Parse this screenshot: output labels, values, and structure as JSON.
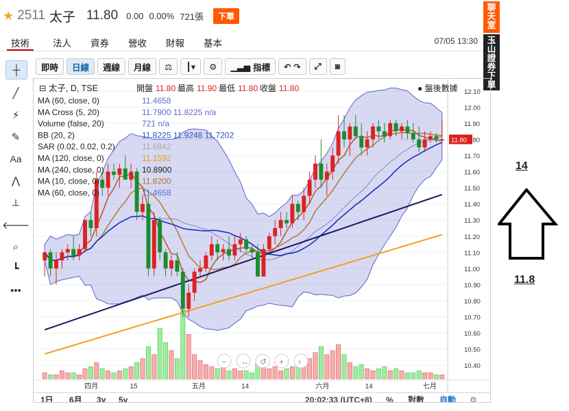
{
  "stock": {
    "code": "2511",
    "name": "太子",
    "price": "11.80",
    "change": "0.00",
    "change_pct": "0.00%",
    "volume": "721張",
    "sell_button": "下單"
  },
  "tabs": [
    "技術",
    "法人",
    "資券",
    "營收",
    "財報",
    "基本"
  ],
  "datetime": "07/05 13:30",
  "side_tags": {
    "tag1": "聊天室",
    "tag2": "玉山證券下單"
  },
  "toolbar": [
    "即時",
    "日線",
    "週線",
    "月線"
  ],
  "toolbar_indicators": "指標",
  "legend": {
    "title": "太子, D, TSE",
    "ohlc_label_open": "開盤",
    "open": "11.80",
    "ohlc_label_high": "最高",
    "high": "11.90",
    "ohlc_label_low": "最低",
    "low": "11.80",
    "ohlc_label_close": "收盤",
    "close": "11.80",
    "after_hours": "盤後數據",
    "rows": [
      {
        "label": "MA (60, close, 0)",
        "values": "11.4658"
      },
      {
        "label": "MA Cross (5, 20)",
        "values": "11.7900  11.8225  n/a"
      },
      {
        "label": "Volume (false, 20)",
        "values": "721  n/a"
      },
      {
        "label": "BB (20, 2)",
        "values": "11.8225  11.9248  11.7202"
      },
      {
        "label": "SAR (0.02, 0.02, 0.2)",
        "values": "11.6842"
      },
      {
        "label": "MA (120, close, 0)",
        "values": "11.1592"
      },
      {
        "label": "MA (240, close, 0)",
        "values": "10.8900"
      },
      {
        "label": "MA (10, close, 0)",
        "values": "11.8200"
      },
      {
        "label": "MA (60, close, 0)",
        "values": "11.4658"
      }
    ]
  },
  "price_axis": [
    "12.10",
    "12.00",
    "11.90",
    "11.80",
    "11.70",
    "11.60",
    "11.50",
    "11.40",
    "11.30",
    "11.20",
    "11.10",
    "11.00",
    "10.90",
    "10.80",
    "10.70",
    "10.60",
    "10.50",
    "10.40"
  ],
  "price_tag": "11.80",
  "time_axis": [
    "四月",
    "15",
    "五月",
    "14",
    "六月",
    "14",
    "七月"
  ],
  "bottom_bar": {
    "ranges": [
      "1日",
      "6月",
      "3y",
      "5y"
    ],
    "time": "20:02:33 (UTC+8)",
    "pct": "%",
    "log": "對數",
    "auto": "自動"
  },
  "annotation": {
    "top": "14",
    "bottom": "11.8"
  },
  "chart_data": {
    "type": "candlestick",
    "ylim": [
      10.35,
      12.15
    ],
    "candles": [
      [
        11.05,
        11.1,
        10.95,
        11.1
      ],
      [
        11.1,
        11.12,
        10.95,
        11.0
      ],
      [
        11.0,
        11.1,
        10.9,
        11.05
      ],
      [
        11.05,
        11.12,
        11.0,
        11.1
      ],
      [
        11.1,
        11.15,
        11.05,
        11.12
      ],
      [
        11.12,
        11.2,
        11.05,
        11.08
      ],
      [
        11.08,
        11.15,
        11.05,
        11.12
      ],
      [
        11.12,
        11.3,
        11.1,
        11.3
      ],
      [
        11.3,
        11.35,
        11.2,
        11.25
      ],
      [
        11.25,
        11.6,
        11.2,
        11.55
      ],
      [
        11.55,
        11.6,
        11.45,
        11.5
      ],
      [
        11.5,
        11.65,
        11.45,
        11.6
      ],
      [
        11.6,
        11.65,
        11.55,
        11.58
      ],
      [
        11.58,
        11.65,
        11.5,
        11.62
      ],
      [
        11.62,
        11.7,
        11.55,
        11.55
      ],
      [
        11.55,
        11.65,
        11.5,
        11.6
      ],
      [
        11.6,
        11.62,
        11.3,
        11.35
      ],
      [
        11.35,
        11.45,
        11.3,
        11.4
      ],
      [
        11.4,
        11.45,
        10.95,
        11.0
      ],
      [
        11.0,
        11.35,
        10.95,
        11.3
      ],
      [
        11.3,
        11.32,
        11.05,
        11.1
      ],
      [
        11.1,
        11.12,
        10.95,
        11.0
      ],
      [
        11.0,
        11.08,
        10.95,
        11.05
      ],
      [
        11.05,
        11.1,
        10.95,
        10.98
      ],
      [
        10.98,
        11.0,
        10.7,
        10.75
      ],
      [
        10.75,
        10.9,
        10.7,
        10.85
      ],
      [
        10.85,
        11.0,
        10.8,
        10.98
      ],
      [
        10.98,
        11.05,
        10.95,
        11.0
      ],
      [
        11.0,
        11.1,
        10.98,
        11.08
      ],
      [
        11.08,
        11.2,
        11.05,
        11.15
      ],
      [
        11.15,
        11.18,
        11.05,
        11.1
      ],
      [
        11.1,
        11.15,
        11.05,
        11.12
      ],
      [
        11.12,
        11.2,
        11.05,
        11.08
      ],
      [
        11.08,
        11.2,
        11.05,
        11.15
      ],
      [
        11.15,
        11.22,
        11.1,
        11.18
      ],
      [
        11.18,
        11.2,
        11.1,
        11.12
      ],
      [
        11.12,
        11.15,
        11.05,
        11.1
      ],
      [
        11.1,
        11.15,
        10.95,
        10.95
      ],
      [
        10.95,
        11.15,
        10.95,
        11.12
      ],
      [
        11.12,
        11.22,
        11.1,
        11.2
      ],
      [
        11.2,
        11.3,
        11.15,
        11.25
      ],
      [
        11.25,
        11.35,
        11.2,
        11.3
      ],
      [
        11.3,
        11.35,
        11.25,
        11.28
      ],
      [
        11.28,
        11.45,
        11.25,
        11.4
      ],
      [
        11.4,
        11.42,
        11.3,
        11.35
      ],
      [
        11.35,
        11.5,
        11.3,
        11.45
      ],
      [
        11.45,
        11.6,
        11.4,
        11.55
      ],
      [
        11.55,
        11.7,
        11.5,
        11.65
      ],
      [
        11.65,
        11.8,
        11.5,
        11.55
      ],
      [
        11.55,
        11.65,
        11.45,
        11.6
      ],
      [
        11.6,
        11.75,
        11.55,
        11.7
      ],
      [
        11.7,
        11.95,
        11.65,
        11.85
      ],
      [
        11.85,
        11.95,
        11.75,
        11.8
      ],
      [
        11.8,
        11.9,
        11.7,
        11.88
      ],
      [
        11.88,
        11.95,
        11.8,
        11.82
      ],
      [
        11.82,
        11.9,
        11.7,
        11.75
      ],
      [
        11.75,
        11.85,
        11.7,
        11.8
      ],
      [
        11.8,
        11.9,
        11.75,
        11.88
      ],
      [
        11.88,
        11.92,
        11.8,
        11.85
      ],
      [
        11.85,
        11.9,
        11.78,
        11.82
      ],
      [
        11.82,
        11.92,
        11.8,
        11.9
      ],
      [
        11.9,
        11.92,
        11.82,
        11.85
      ],
      [
        11.85,
        11.9,
        11.8,
        11.88
      ],
      [
        11.88,
        11.92,
        11.8,
        11.84
      ],
      [
        11.84,
        11.9,
        11.78,
        11.8
      ],
      [
        11.8,
        11.88,
        11.72,
        11.75
      ],
      [
        11.75,
        11.85,
        11.72,
        11.8
      ],
      [
        11.8,
        11.85,
        11.78,
        11.82
      ],
      [
        11.82,
        11.84,
        11.78,
        11.8
      ],
      [
        11.8,
        11.92,
        11.78,
        11.8
      ]
    ],
    "volumes": [
      3,
      2,
      2,
      4,
      3,
      3,
      2,
      5,
      6,
      8,
      5,
      4,
      3,
      4,
      5,
      6,
      8,
      10,
      16,
      12,
      25,
      18,
      14,
      10,
      34,
      22,
      12,
      9,
      7,
      6,
      5,
      6,
      4,
      5,
      4,
      4,
      3,
      8,
      6,
      5,
      6,
      4,
      5,
      6,
      7,
      9,
      10,
      13,
      16,
      12,
      14,
      17,
      12,
      8,
      6,
      7,
      5,
      4,
      5,
      6,
      4,
      5,
      4,
      3,
      3,
      4,
      3,
      3,
      2,
      2
    ]
  }
}
